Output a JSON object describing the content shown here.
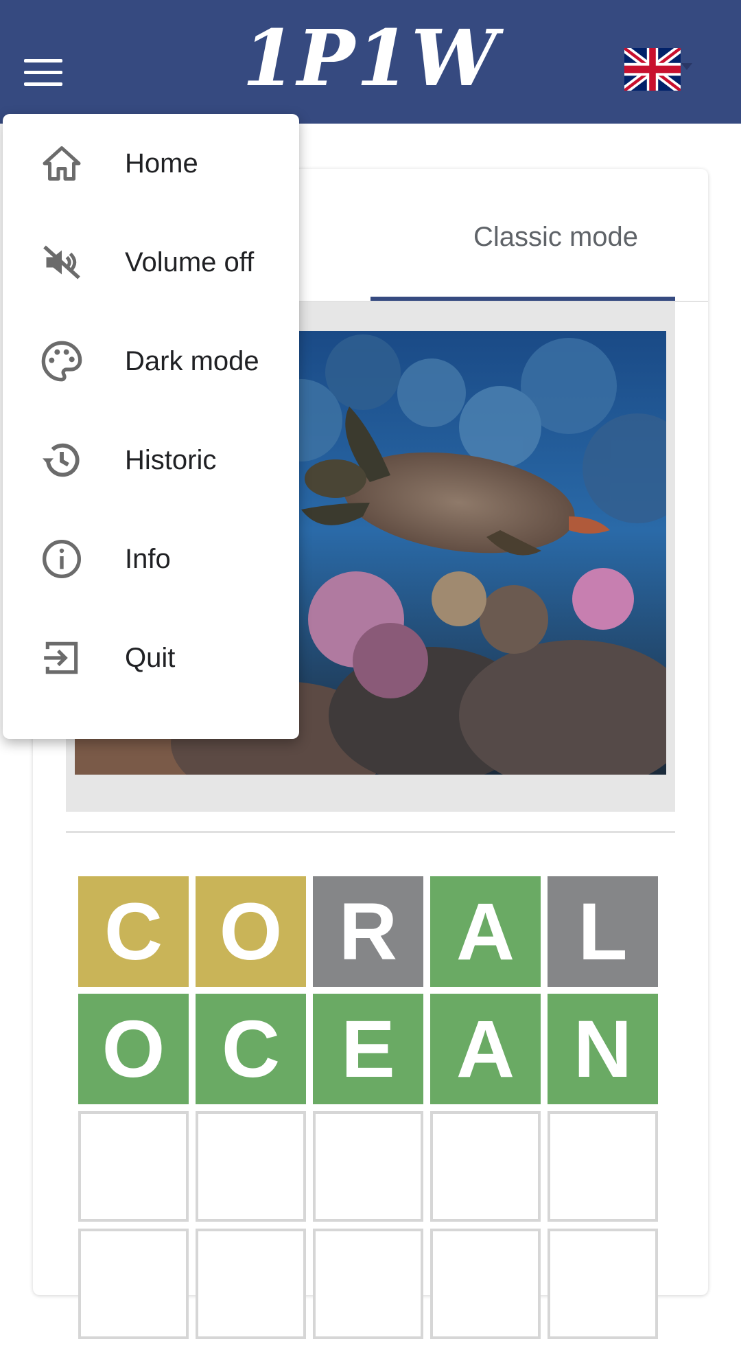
{
  "header": {
    "logo": "1P1W",
    "language_flag": "uk-flag-icon",
    "menu_icon": "hamburger-icon",
    "background": "#364a80"
  },
  "tabs": [
    {
      "label": "",
      "active": false
    },
    {
      "label": "Classic mode",
      "active": true
    }
  ],
  "image": {
    "description": "sea turtle swimming over a coral reef"
  },
  "menu": {
    "items": [
      {
        "label": "Home",
        "icon": "home-icon"
      },
      {
        "label": "Volume off",
        "icon": "volume-off-icon"
      },
      {
        "label": "Dark mode",
        "icon": "palette-icon"
      },
      {
        "label": "Historic",
        "icon": "history-icon"
      },
      {
        "label": "Info",
        "icon": "info-icon"
      },
      {
        "label": "Quit",
        "icon": "exit-icon"
      }
    ]
  },
  "grid": {
    "rows": [
      [
        {
          "letter": "C",
          "state": "present"
        },
        {
          "letter": "O",
          "state": "present"
        },
        {
          "letter": "R",
          "state": "absent"
        },
        {
          "letter": "A",
          "state": "correct"
        },
        {
          "letter": "L",
          "state": "absent"
        }
      ],
      [
        {
          "letter": "O",
          "state": "correct"
        },
        {
          "letter": "C",
          "state": "correct"
        },
        {
          "letter": "E",
          "state": "correct"
        },
        {
          "letter": "A",
          "state": "correct"
        },
        {
          "letter": "N",
          "state": "correct"
        }
      ],
      [
        {
          "letter": "",
          "state": "empty"
        },
        {
          "letter": "",
          "state": "empty"
        },
        {
          "letter": "",
          "state": "empty"
        },
        {
          "letter": "",
          "state": "empty"
        },
        {
          "letter": "",
          "state": "empty"
        }
      ],
      [
        {
          "letter": "",
          "state": "empty"
        },
        {
          "letter": "",
          "state": "empty"
        },
        {
          "letter": "",
          "state": "empty"
        },
        {
          "letter": "",
          "state": "empty"
        },
        {
          "letter": "",
          "state": "empty"
        }
      ]
    ],
    "colors": {
      "present": "#c9b458",
      "absent": "#858688",
      "correct": "#6aaa64"
    }
  }
}
